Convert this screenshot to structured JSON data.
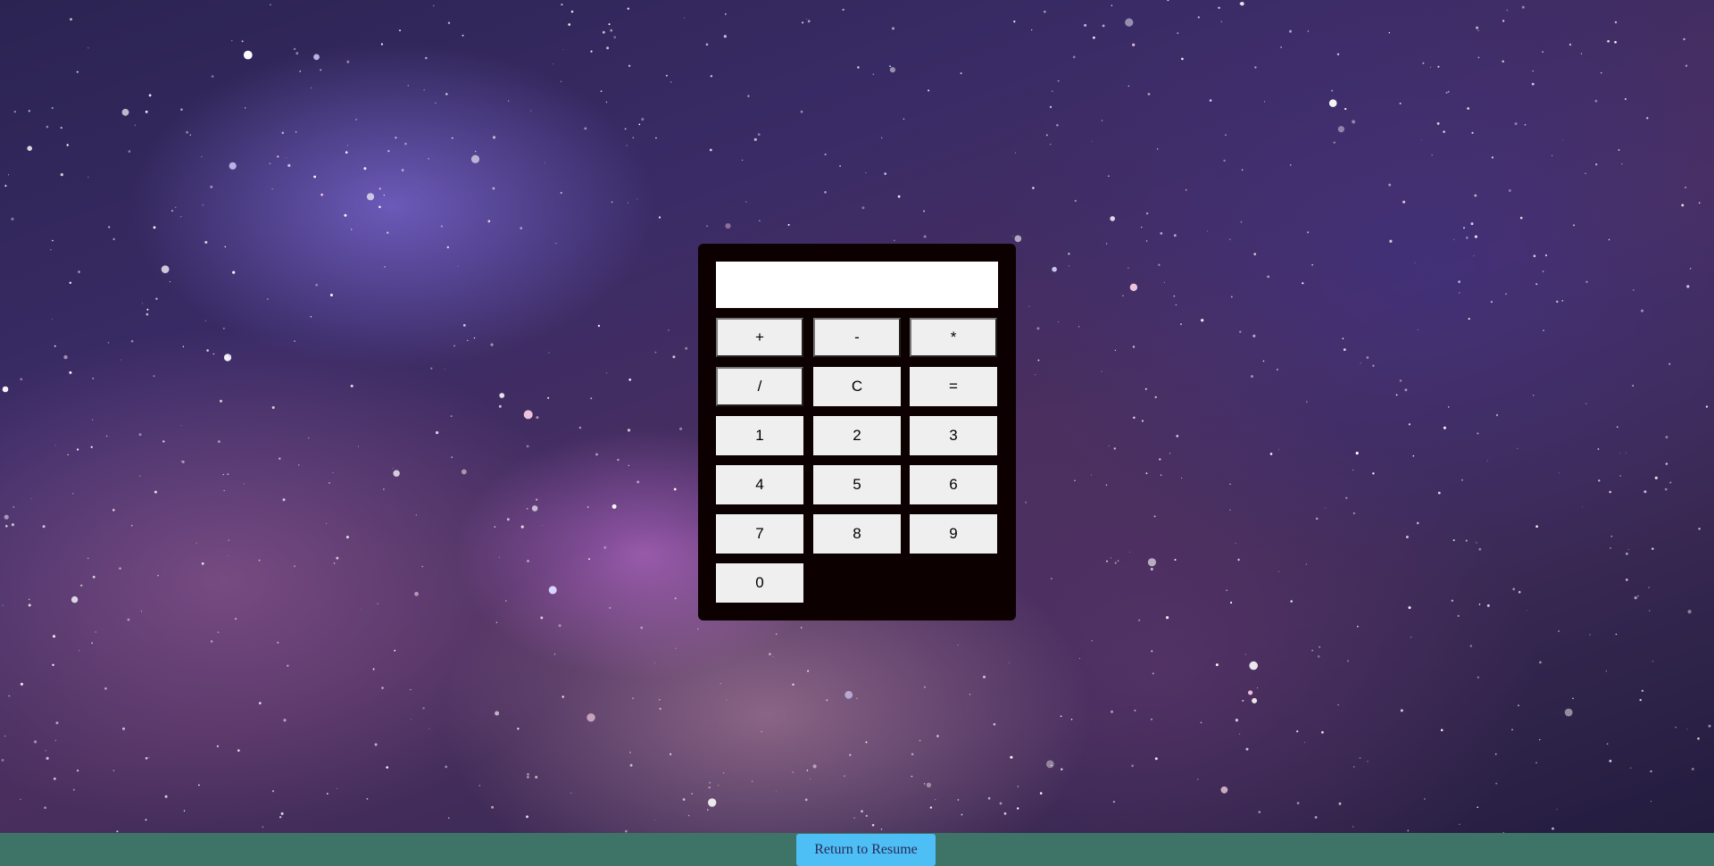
{
  "display": {
    "value": ""
  },
  "keys": {
    "plus": "+",
    "minus": "-",
    "multiply": "*",
    "divide": "/",
    "clear": "C",
    "equals": "=",
    "one": "1",
    "two": "2",
    "three": "3",
    "four": "4",
    "five": "5",
    "six": "6",
    "seven": "7",
    "eight": "8",
    "nine": "9",
    "zero": "0"
  },
  "footer": {
    "return_label": "Return to Resume"
  },
  "colors": {
    "calculator_body": "#0c0000",
    "key_background": "#efefef",
    "footer_background": "#3e7468",
    "return_button": "#4dbff5"
  },
  "background": {
    "theme": "galaxy-starfield"
  }
}
